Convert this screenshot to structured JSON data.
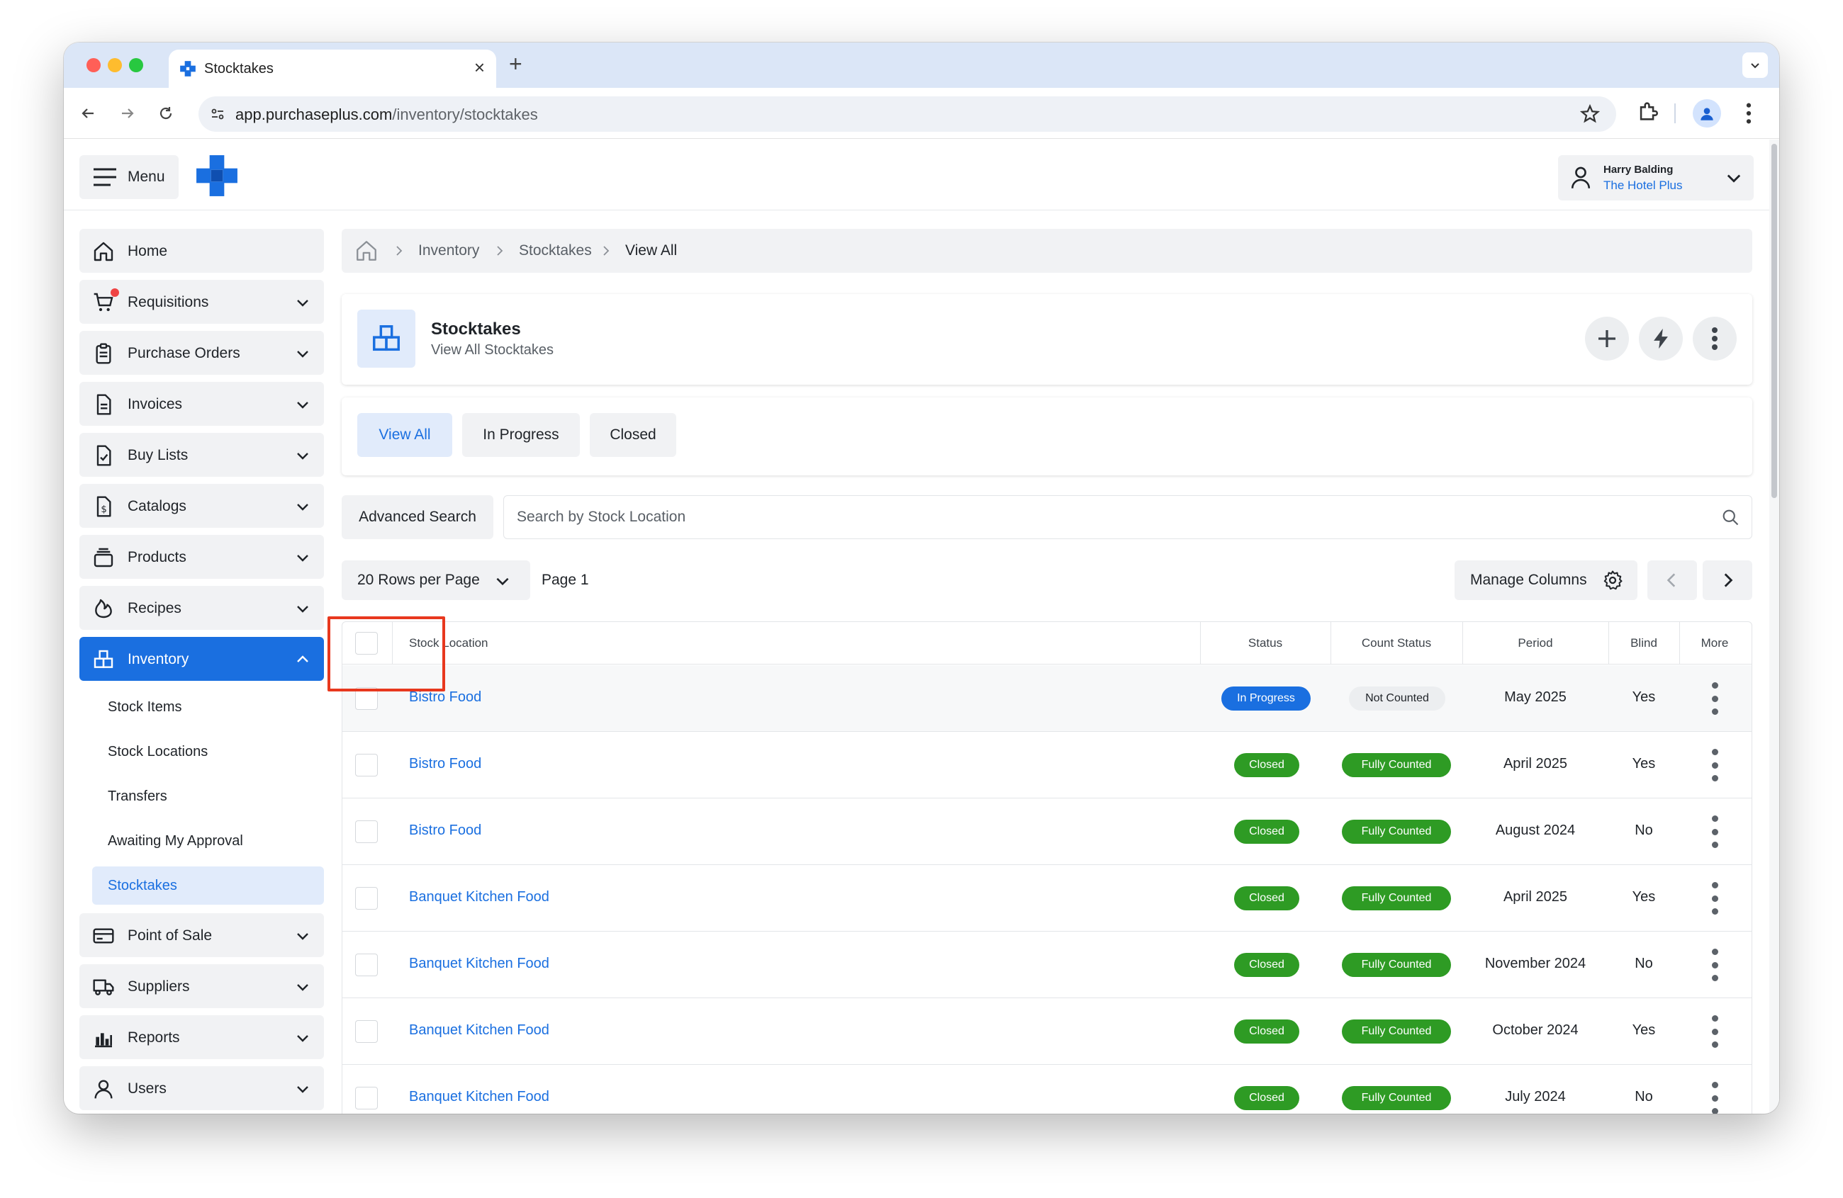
{
  "browser": {
    "tab_title": "Stocktakes",
    "url_domain": "app.purchaseplus.com",
    "url_path": "/inventory/stocktakes",
    "new_tab_symbol": "+"
  },
  "header": {
    "menu_label": "Menu",
    "user_name": "Harry Balding",
    "user_org": "The Hotel Plus"
  },
  "sidebar": {
    "items": [
      {
        "label": "Home",
        "icon": "home-icon"
      },
      {
        "label": "Requisitions",
        "icon": "cart-icon"
      },
      {
        "label": "Purchase Orders",
        "icon": "clipboard-icon"
      },
      {
        "label": "Invoices",
        "icon": "document-icon"
      },
      {
        "label": "Buy Lists",
        "icon": "checklist-icon"
      },
      {
        "label": "Catalogs",
        "icon": "dollar-document-icon"
      },
      {
        "label": "Products",
        "icon": "stack-icon"
      },
      {
        "label": "Recipes",
        "icon": "flame-icon"
      },
      {
        "label": "Inventory",
        "icon": "boxes-icon"
      },
      {
        "label": "Point of Sale",
        "icon": "card-icon"
      },
      {
        "label": "Suppliers",
        "icon": "truck-icon"
      },
      {
        "label": "Reports",
        "icon": "bar-chart-icon"
      },
      {
        "label": "Users",
        "icon": "user-icon"
      }
    ],
    "inventory_sub": [
      "Stock Items",
      "Stock Locations",
      "Transfers",
      "Awaiting My Approval",
      "Stocktakes"
    ]
  },
  "breadcrumb": {
    "items": [
      "Inventory",
      "Stocktakes",
      "View All"
    ]
  },
  "page": {
    "title": "Stocktakes",
    "subtitle": "View All Stocktakes"
  },
  "filter_tabs": [
    "View All",
    "In Progress",
    "Closed"
  ],
  "search": {
    "advanced_label": "Advanced Search",
    "placeholder": "Search by Stock Location"
  },
  "pagination": {
    "rows_label": "20 Rows per Page",
    "page_label": "Page 1",
    "manage_columns_label": "Manage Columns"
  },
  "table": {
    "columns": [
      "Stock Location",
      "Status",
      "Count Status",
      "Period",
      "Blind",
      "More"
    ],
    "rows": [
      {
        "location": "Bistro Food",
        "status": "In Progress",
        "count_status": "Not Counted",
        "period": "May 2025",
        "blind": "Yes"
      },
      {
        "location": "Bistro Food",
        "status": "Closed",
        "count_status": "Fully Counted",
        "period": "April 2025",
        "blind": "Yes"
      },
      {
        "location": "Bistro Food",
        "status": "Closed",
        "count_status": "Fully Counted",
        "period": "August 2024",
        "blind": "No"
      },
      {
        "location": "Banquet Kitchen Food",
        "status": "Closed",
        "count_status": "Fully Counted",
        "period": "April 2025",
        "blind": "Yes"
      },
      {
        "location": "Banquet Kitchen Food",
        "status": "Closed",
        "count_status": "Fully Counted",
        "period": "November 2024",
        "blind": "No"
      },
      {
        "location": "Banquet Kitchen Food",
        "status": "Closed",
        "count_status": "Fully Counted",
        "period": "October 2024",
        "blind": "Yes"
      },
      {
        "location": "Banquet Kitchen Food",
        "status": "Closed",
        "count_status": "Fully Counted",
        "period": "July 2024",
        "blind": "No"
      }
    ]
  },
  "colors": {
    "brand_blue": "#1a6fe0",
    "status_green": "#2e9b24",
    "highlight_red": "#e8381e"
  }
}
